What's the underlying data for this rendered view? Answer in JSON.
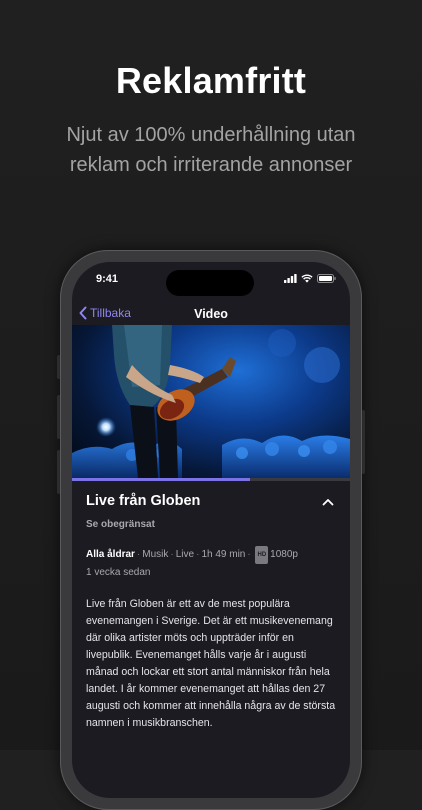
{
  "promo": {
    "headline": "Reklamfritt",
    "subline": "Njut av 100% underhållning utan reklam och irriterande annonser"
  },
  "status_bar": {
    "time": "9:41"
  },
  "navbar": {
    "back_label": "Tillbaka",
    "title": "Video"
  },
  "player": {
    "progress": 0.64
  },
  "video": {
    "title": "Live från Globen",
    "availability": "Se obegränsat",
    "meta": {
      "age_rating": "Alla åldrar",
      "genre": "Musik",
      "type": "Live",
      "duration": "1h 49 min",
      "hd_badge": "HD",
      "resolution": "1080p",
      "published": "1 vecka sedan"
    },
    "description": "Live från Globen är ett av de mest populära evenemangen i Sverige. Det är ett musikevenemang där olika artister möts och uppträder inför en livepublik. Evenemanget hålls varje år i augusti månad och lockar ett stort antal människor från hela landet. I år kommer evenemanget att hållas den 27 augusti och kommer att innehålla några av de största namnen i musikbranschen."
  },
  "colors": {
    "accent": "#7c73e6",
    "background": "#1c1b21",
    "page": "#1e1e1e"
  },
  "icons": [
    "chevron-left-icon",
    "chevron-up-icon",
    "signal-icon",
    "wifi-icon",
    "battery-icon"
  ]
}
